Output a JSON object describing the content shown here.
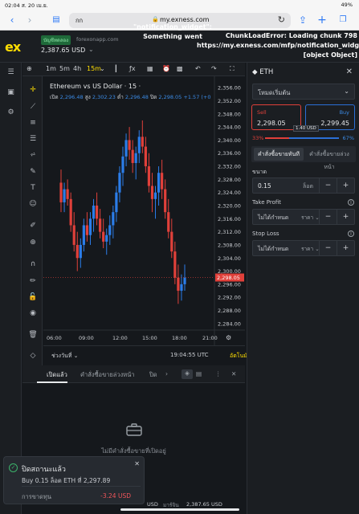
{
  "ios": {
    "time": "02:04",
    "date": "ส. 20 เม.ย.",
    "battery": "49%"
  },
  "browser": {
    "aa": "กก",
    "url": "my.exness.com",
    "share_icon": "share-icon",
    "new_tab_icon": "plus-icon",
    "tabs_icon": "tabs-icon"
  },
  "header": {
    "logo": "ex",
    "account_badge": "บัญชีทดลอง",
    "account_site": "forexonapp.com",
    "balance": "2,387.65 USD",
    "error_middle": "\"notification_widget\": Something went",
    "error_right": "ChunkLoadError: Loading chunk 798 https://my.exness.com/mfp/notification_widget [object Object]"
  },
  "chart_toolbar": {
    "tf1": "1m",
    "tf2": "5m",
    "tf3": "4h",
    "tf4": "15m"
  },
  "chart": {
    "title": "Ethereum vs US Dollar · 15 ·",
    "o_label": "เปิด",
    "o": "2,296.48",
    "h_label": "สูง",
    "h": "2,302.23",
    "l_label": "ต่ำ",
    "l": "2,296.48",
    "c_label": "ปิด",
    "c": "2,298.05",
    "change": "+1.57 (+0",
    "price_tag": "2,298.05",
    "range_label": "ช่วงวันที่",
    "clock": "19:04:55 UTC",
    "auto": "อัตโนมัติ"
  },
  "chart_data": {
    "type": "candlestick",
    "title": "Ethereum vs US Dollar · 15 ·",
    "yticks": [
      2356,
      2352,
      2348,
      2344,
      2340,
      2336,
      2332,
      2328,
      2324,
      2320,
      2316,
      2312,
      2308,
      2304,
      2300,
      2296,
      2292,
      2288,
      2284
    ],
    "ylim": [
      2282,
      2358
    ],
    "xticks": [
      "06:00",
      "09:00",
      "12:00",
      "15:00",
      "18:00",
      "21:00"
    ],
    "candles": [
      [
        2327,
        2331,
        2318,
        2321
      ],
      [
        2321,
        2327,
        2318,
        2325
      ],
      [
        2325,
        2328,
        2320,
        2322
      ],
      [
        2322,
        2324,
        2312,
        2314
      ],
      [
        2314,
        2318,
        2306,
        2308
      ],
      [
        2308,
        2312,
        2300,
        2304
      ],
      [
        2304,
        2310,
        2301,
        2308
      ],
      [
        2308,
        2316,
        2306,
        2314
      ],
      [
        2314,
        2318,
        2309,
        2311
      ],
      [
        2311,
        2318,
        2308,
        2316
      ],
      [
        2316,
        2322,
        2312,
        2320
      ],
      [
        2320,
        2324,
        2314,
        2316
      ],
      [
        2316,
        2319,
        2310,
        2312
      ],
      [
        2312,
        2316,
        2307,
        2309
      ],
      [
        2309,
        2313,
        2305,
        2311
      ],
      [
        2311,
        2317,
        2308,
        2314
      ],
      [
        2314,
        2320,
        2310,
        2318
      ],
      [
        2318,
        2326,
        2315,
        2324
      ],
      [
        2324,
        2332,
        2321,
        2330
      ],
      [
        2330,
        2338,
        2326,
        2335
      ],
      [
        2335,
        2342,
        2332,
        2340
      ],
      [
        2340,
        2344,
        2334,
        2337
      ],
      [
        2337,
        2340,
        2330,
        2333
      ],
      [
        2333,
        2338,
        2328,
        2336
      ],
      [
        2336,
        2343,
        2333,
        2341
      ],
      [
        2341,
        2346,
        2336,
        2338
      ],
      [
        2338,
        2341,
        2330,
        2332
      ],
      [
        2332,
        2336,
        2324,
        2326
      ],
      [
        2326,
        2330,
        2318,
        2322
      ],
      [
        2322,
        2326,
        2316,
        2324
      ],
      [
        2324,
        2332,
        2320,
        2330
      ],
      [
        2330,
        2334,
        2322,
        2325
      ],
      [
        2325,
        2328,
        2316,
        2318
      ],
      [
        2318,
        2322,
        2310,
        2312
      ],
      [
        2312,
        2316,
        2304,
        2306
      ],
      [
        2306,
        2309,
        2296,
        2298
      ],
      [
        2298,
        2302,
        2290,
        2294
      ],
      [
        2294,
        2299,
        2291,
        2296
      ],
      [
        2296,
        2302,
        2294,
        2298
      ]
    ],
    "last_price": 2298.05
  },
  "drawing_tools": [
    "crosshair-icon",
    "trendline-icon",
    "horizontal-lines-icon",
    "fib-icon",
    "brush-icon",
    "text-icon",
    "emoji-icon",
    "ruler-icon",
    "zoom-icon",
    "magnet-icon",
    "lock-drawing-icon",
    "lock-icon",
    "eye-icon",
    "trash-icon"
  ],
  "positions": {
    "tab_open": "เปิดแล้ว",
    "tab_pending": "คำสั่งซื้อขายล่วงหน้า",
    "tab_closed": "ปิด",
    "empty": "ไม่มีคำสั่งซื้อขายที่เปิดอยู่"
  },
  "toast": {
    "title": "ปิดสถานะแล้ว",
    "detail": "Buy 0.15 ล็อต ETH ที่ 2,297.89",
    "pl_label": "การขาดทุน",
    "pl_value": "-3.24 USD"
  },
  "order_panel": {
    "symbol": "ETH",
    "mode": "โหมดเริ่มต้น",
    "sell_label": "Sell",
    "sell_price": "2,298.05",
    "buy_label": "Buy",
    "buy_price": "2,299.45",
    "spread": "1.40 USD",
    "sell_pct": "33%",
    "buy_pct": "67%",
    "sell_fraction": 0.33,
    "order_market": "คำสั่งซื้อขายทันที",
    "order_pending": "คำสั่งซื้อขายล่วงหน้า",
    "volume_label": "ขนาด",
    "volume": "0.15",
    "volume_unit": "ล็อต",
    "tp_label": "Take Profit",
    "tp_placeholder": "ไม่ได้กำหนด",
    "tp_select": "ราคา",
    "sl_label": "Stop Loss",
    "sl_placeholder": "ไม่ได้กำหนด",
    "sl_select": "ราคา"
  },
  "status_bar": {
    "usd": "USD",
    "margin_label": "มาร์จิน",
    "margin": "2,387.65 USD"
  }
}
